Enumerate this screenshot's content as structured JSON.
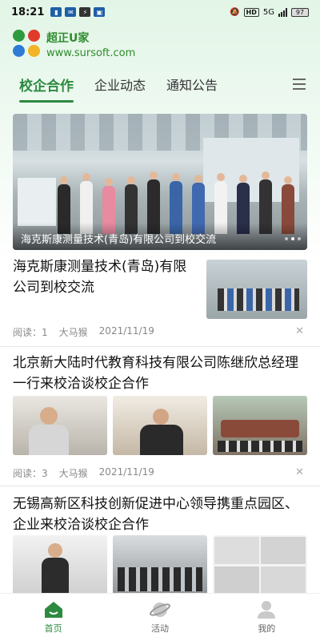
{
  "status": {
    "time": "18:21",
    "network": "5G",
    "battery": "97"
  },
  "brand": {
    "name": "超正U家",
    "url": "www.sursoft.com"
  },
  "tabs": [
    {
      "label": "校企合作",
      "active": true
    },
    {
      "label": "企业动态",
      "active": false
    },
    {
      "label": "通知公告",
      "active": false
    }
  ],
  "banner": {
    "caption": "海克斯康测量技术(青岛)有限公司到校交流"
  },
  "articles": [
    {
      "title": "海克斯康测量技术(青岛)有限公司到校交流",
      "read_label": "阅读：",
      "reads": "1",
      "author": "大马猴",
      "date": "2021/11/19"
    },
    {
      "title": "北京新大陆时代教育科技有限公司陈继欣总经理一行来校洽谈校企合作",
      "read_label": "阅读：",
      "reads": "3",
      "author": "大马猴",
      "date": "2021/11/19"
    },
    {
      "title": "无锡高新区科技创新促进中心领导携重点园区、企业来校洽谈校企合作"
    }
  ],
  "bottom_nav": [
    {
      "label": "首页",
      "icon": "home-icon",
      "active": true
    },
    {
      "label": "活动",
      "icon": "planet-icon",
      "active": false
    },
    {
      "label": "我的",
      "icon": "user-icon",
      "active": false
    }
  ],
  "colors": {
    "accent": "#2d8a40",
    "logo": [
      "#2e9a3e",
      "#e23a2a",
      "#2d7bd6",
      "#f2b325"
    ]
  }
}
